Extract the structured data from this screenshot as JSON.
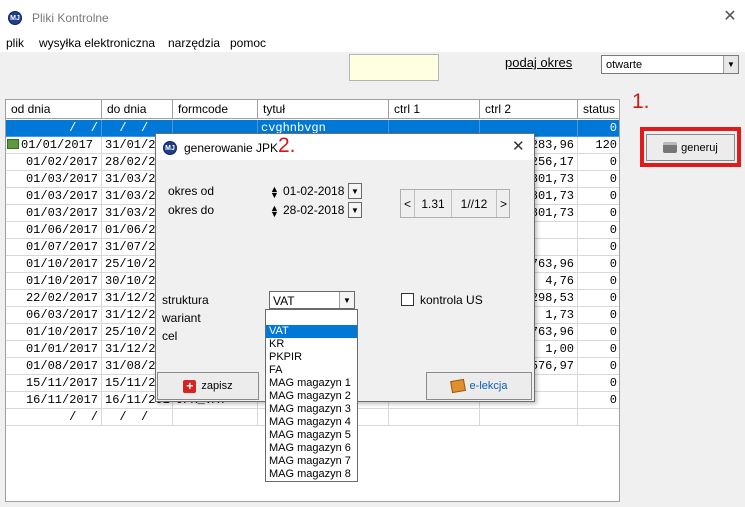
{
  "window": {
    "title": "Pliki Kontrolne",
    "app_icon_text": "MJ"
  },
  "menu": [
    "plik",
    "wysyłka elektroniczna",
    "narzędzia",
    "pomoc"
  ],
  "toolbar": {
    "search_value": "",
    "period_link": "podaj okres",
    "status_select": "otwarte",
    "generate_label": "generuj",
    "step_marker": "1."
  },
  "grid": {
    "headers": [
      "od dnia",
      "do dnia",
      "formcode",
      "tytuł",
      "ctrl 1",
      "ctrl 2",
      "status"
    ],
    "rows": [
      {
        "od": "  /  /",
        "do": "  /  /",
        "formcode": "",
        "tytul": "cvghnbvgn",
        "ctrl1": "",
        "ctrl2": "",
        "status": "0",
        "selected": true
      },
      {
        "od": "01/01/2017",
        "do": "31/01/20",
        "formcode": "",
        "tytul": "",
        "ctrl1": "",
        "ctrl2": "283,96",
        "status": "120",
        "icon": true
      },
      {
        "od": "01/02/2017",
        "do": "28/02/20",
        "formcode": "",
        "tytul": "",
        "ctrl1": "",
        "ctrl2": "256,17",
        "status": "0"
      },
      {
        "od": "01/03/2017",
        "do": "31/03/20",
        "formcode": "",
        "tytul": "",
        "ctrl1": "",
        "ctrl2": "801,73",
        "status": "0"
      },
      {
        "od": "01/03/2017",
        "do": "31/03/20",
        "formcode": "",
        "tytul": "",
        "ctrl1": "",
        "ctrl2": "801,73",
        "status": "0"
      },
      {
        "od": "01/03/2017",
        "do": "31/03/20",
        "formcode": "",
        "tytul": "",
        "ctrl1": "",
        "ctrl2": "801,73",
        "status": "0"
      },
      {
        "od": "01/06/2017",
        "do": "01/06/20",
        "formcode": "",
        "tytul": "",
        "ctrl1": "",
        "ctrl2": "",
        "status": "0"
      },
      {
        "od": "01/07/2017",
        "do": "31/07/20",
        "formcode": "",
        "tytul": "",
        "ctrl1": "",
        "ctrl2": "",
        "status": "0"
      },
      {
        "od": "01/10/2017",
        "do": "25/10/20",
        "formcode": "",
        "tytul": "",
        "ctrl1": "",
        "ctrl2": "763,96",
        "status": "0"
      },
      {
        "od": "01/10/2017",
        "do": "30/10/20",
        "formcode": "",
        "tytul": "",
        "ctrl1": "",
        "ctrl2": "4,76",
        "status": "0"
      },
      {
        "od": "22/02/2017",
        "do": "31/12/20",
        "formcode": "",
        "tytul": "",
        "ctrl1": "",
        "ctrl2": "298,53",
        "status": "0"
      },
      {
        "od": "06/03/2017",
        "do": "31/12/20",
        "formcode": "",
        "tytul": "",
        "ctrl1": "",
        "ctrl2": "1,73",
        "status": "0"
      },
      {
        "od": "01/10/2017",
        "do": "25/10/20",
        "formcode": "",
        "tytul": "",
        "ctrl1": "",
        "ctrl2": "763,96",
        "status": "0"
      },
      {
        "od": "01/01/2017",
        "do": "31/12/20",
        "formcode": "",
        "tytul": "",
        "ctrl1": "",
        "ctrl2": "1,00",
        "status": "0"
      },
      {
        "od": "01/08/2017",
        "do": "31/08/20",
        "formcode": "",
        "tytul": "",
        "ctrl1": "",
        "ctrl2": "576,97",
        "status": "0"
      },
      {
        "od": "15/11/2017",
        "do": "15/11/2017",
        "formcode": "",
        "tytul": "",
        "ctrl1": "",
        "ctrl2": "",
        "status": "0"
      },
      {
        "od": "16/11/2017",
        "do": "16/11/2017",
        "formcode": "JPK_VAT",
        "tytul": "",
        "ctrl1": "",
        "ctrl2": "",
        "status": "0"
      },
      {
        "od": "  /  /",
        "do": "  /  /",
        "formcode": "",
        "tytul": "",
        "ctrl1": "",
        "ctrl2": "",
        "status": ""
      }
    ]
  },
  "dialog": {
    "title": "generowanie JPK",
    "step_marker": "2.",
    "okres_od_label": "okres od",
    "okres_od_value": "01-02-2018",
    "okres_do_label": "okres do",
    "okres_do_value": "28-02-2018",
    "pager_prev": "<",
    "pager_version": "1.31",
    "pager_page": "1//12",
    "pager_next": ">",
    "struktura_label": "struktura",
    "struktura_value": "VAT",
    "wariant_label": "wariant",
    "cel_label": "cel",
    "kontrola_label": "kontrola US",
    "kontrola_checked": false,
    "save_label": "zapisz",
    "elekcja_label": "e-lekcja"
  },
  "struktura_options": [
    "",
    "VAT",
    "KR",
    "PKPIR",
    "FA",
    "MAG magazyn 1",
    "MAG magazyn 2",
    "MAG magazyn 3",
    "MAG magazyn 4",
    "MAG magazyn 5",
    "MAG magazyn 6",
    "MAG magazyn 7",
    "MAG magazyn 8"
  ],
  "struktura_selected_index": 1,
  "colors": {
    "accent": "#0078d7",
    "marker": "#d01919",
    "yellow_input": "#ffffe1"
  }
}
